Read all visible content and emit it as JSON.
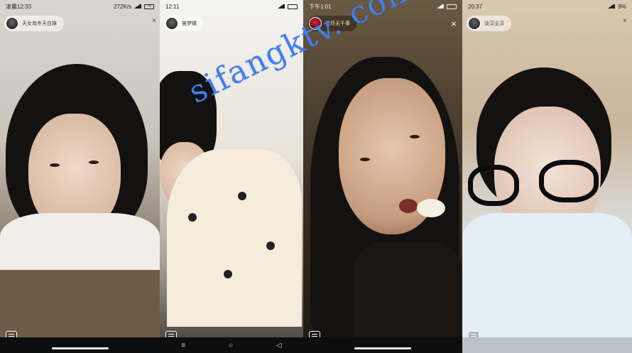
{
  "panels": [
    {
      "status": {
        "time": "凌晨12:33",
        "net": "272K/s",
        "battery": "75"
      },
      "user": {
        "name": "天女岛冬天白妹"
      }
    },
    {
      "status": {
        "time": "12:11",
        "battery": ""
      },
      "user": {
        "name": "笛梦蝶"
      }
    },
    {
      "status": {
        "time": "下午1:01",
        "battery": ""
      },
      "user": {
        "name": "无尽无千事"
      }
    },
    {
      "status": {
        "time": "20:37",
        "battery": "9%"
      },
      "user": {
        "name": "淡汉尘汉"
      }
    }
  ],
  "close_label": "×",
  "nav": {
    "back": "◁",
    "home": "○",
    "recent": "□"
  },
  "watermark": "sifangktv. com",
  "colors": {
    "watermark": "#3f7ff0"
  }
}
